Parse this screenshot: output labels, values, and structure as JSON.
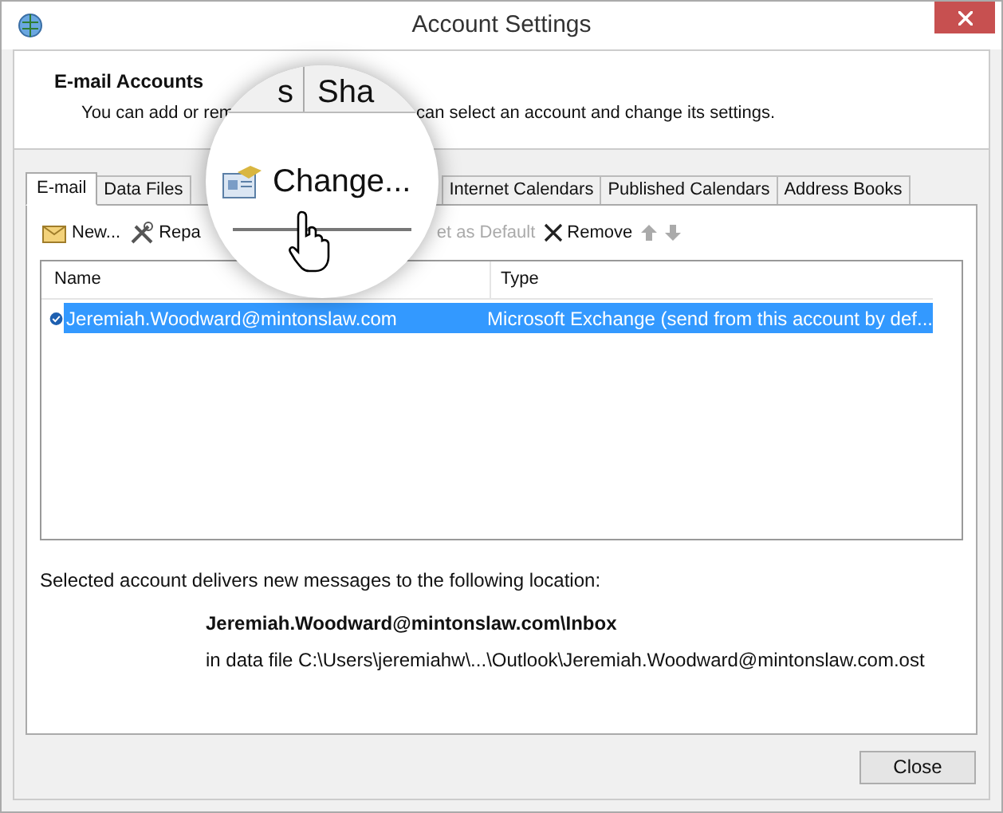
{
  "window": {
    "title": "Account Settings"
  },
  "header": {
    "title": "E-mail Accounts",
    "description_start": "You can add or rem",
    "description_end": "can select an account and change its settings."
  },
  "tabs": [
    {
      "label": "E-mail",
      "selected": true
    },
    {
      "label": "Data Files",
      "selected": false
    },
    {
      "label": "Internet Calendars",
      "selected": false
    },
    {
      "label": "Published Calendars",
      "selected": false
    },
    {
      "label": "Address Books",
      "selected": false
    }
  ],
  "toolbar": [
    {
      "label": "New...",
      "kind": "new",
      "disabled": false
    },
    {
      "label": "Repa",
      "kind": "repair",
      "disabled": false
    },
    {
      "label": "et as Default",
      "kind": "default",
      "disabled": true
    },
    {
      "label": "Remove",
      "kind": "remove",
      "disabled": false
    },
    {
      "kind": "up",
      "disabled": true
    },
    {
      "kind": "down",
      "disabled": true
    }
  ],
  "table": {
    "columns": [
      "Name",
      "Type"
    ],
    "rows": [
      {
        "name": "Jeremiah.Woodward@mintonslaw.com",
        "type": "Microsoft Exchange (send from this account by def...",
        "selected": true,
        "default": true
      }
    ]
  },
  "delivery": {
    "intro": "Selected account delivers new messages to the following location:",
    "folder": "Jeremiah.Woodward@mintonslaw.com\\Inbox",
    "data_file": "in data file C:\\Users\\jeremiahw\\...\\Outlook\\Jeremiah.Woodward@mintonslaw.com.ost"
  },
  "magnifier": {
    "tab_fragments": [
      "s",
      "Sha"
    ],
    "button": "Change..."
  },
  "buttons": [
    "Close"
  ]
}
